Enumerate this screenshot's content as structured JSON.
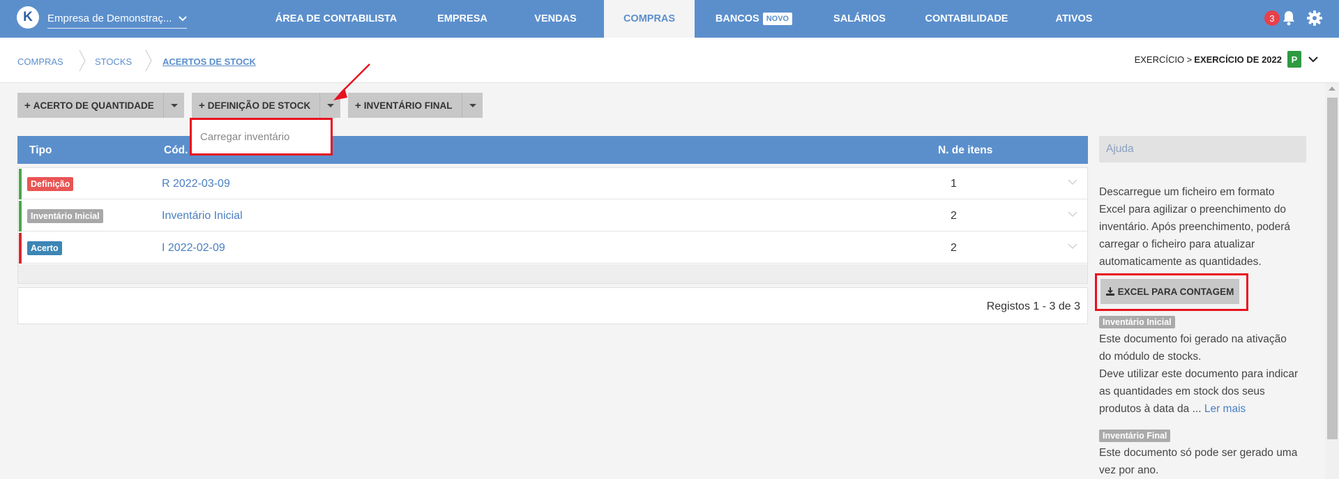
{
  "topnav": {
    "company_name": "Empresa de Demonstraç...",
    "items": [
      {
        "label": "ÁREA DE CONTABILISTA"
      },
      {
        "label": "EMPRESA"
      },
      {
        "label": "VENDAS"
      },
      {
        "label": "COMPRAS"
      },
      {
        "label": "BANCOS",
        "badge": "NOVO"
      },
      {
        "label": "SALÁRIOS"
      },
      {
        "label": "CONTABILIDADE"
      },
      {
        "label": "ATIVOS"
      }
    ],
    "active": "COMPRAS",
    "notification_count": "3",
    "icons": [
      "bell-icon",
      "gear-icon"
    ],
    "colors": {
      "bar": "#5b8fcc",
      "badge": "#e8404b"
    }
  },
  "breadcrumb": {
    "items": [
      "COMPRAS",
      "STOCKS",
      "ACERTOS DE STOCK"
    ]
  },
  "exercise": {
    "prefix": "EXERCÍCIO >",
    "value": "EXERCÍCIO DE 2022",
    "badge": "P",
    "badge_color": "#2f9a41"
  },
  "actions": {
    "qty_adjust": "ACERTO DE QUANTIDADE",
    "stock_definition": "DEFINIÇÃO DE STOCK",
    "final_inventory": "INVENTÁRIO FINAL",
    "dropdown_item": "Carregar inventário"
  },
  "table": {
    "headers": {
      "type": "Tipo",
      "code": "Cód.",
      "items": "N. de itens"
    },
    "rows": [
      {
        "type": "Definição",
        "type_color": "#e95454",
        "stripe": "#4aa64a",
        "code": "R 2022-03-09",
        "items": "1"
      },
      {
        "type": "Inventário Inicial",
        "type_color": "#a8a8a8",
        "stripe": "#4aa64a",
        "code": "Inventário Inicial",
        "items": "2"
      },
      {
        "type": "Acerto",
        "type_color": "#3c86b5",
        "stripe": "#d9252d",
        "code": "I 2022-02-09",
        "items": "2"
      }
    ],
    "pager": "Registos 1 - 3 de 3"
  },
  "help": {
    "title": "Ajuda",
    "intro_lines": [
      "Descarregue um ficheiro em formato",
      "Excel para agilizar o preenchimento do",
      "inventário. Após preenchimento, poderá",
      "carregar o ficheiro para atualizar",
      "automaticamente as quantidades."
    ],
    "excel_button": "EXCEL PARA CONTAGEM",
    "initial_tag": "Inventário Inicial",
    "initial_lines": [
      "Este documento foi gerado na ativação",
      "do módulo de stocks.",
      "Deve utilizar este documento para indicar",
      "as quantidades em stock dos seus",
      "produtos à data da"
    ],
    "ellipsis": "...",
    "read_more": "Ler mais",
    "final_tag": "Inventário Final",
    "final_lines": [
      "Este documento só pode ser gerado uma",
      "vez por ano."
    ]
  }
}
